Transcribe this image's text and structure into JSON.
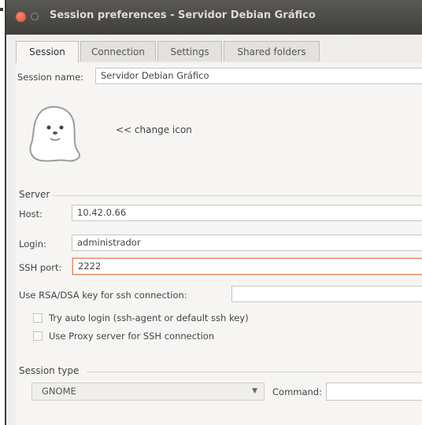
{
  "window": {
    "title": "Session preferences - Servidor Debian Gráfico"
  },
  "tabs": [
    {
      "label": "Session"
    },
    {
      "label": "Connection"
    },
    {
      "label": "Settings"
    },
    {
      "label": "Shared folders"
    }
  ],
  "session": {
    "name_label": "Session name:",
    "name_value": "Servidor Debian Gráfico",
    "change_icon_label": "<< change icon"
  },
  "server": {
    "section_label": "Server",
    "host_label": "Host:",
    "host_value": "10.42.0.66",
    "login_label": "Login:",
    "login_value": "administrador",
    "ssh_port_label": "SSH port:",
    "ssh_port_value": "2222",
    "rsa_label": "Use RSA/DSA key for ssh connection:",
    "rsa_value": "",
    "auto_login_label": "Try auto login (ssh-agent or default ssh key)",
    "proxy_label": "Use Proxy server for SSH connection"
  },
  "session_type": {
    "section_label": "Session type",
    "selected": "GNOME",
    "command_label": "Command:",
    "command_value": ""
  },
  "colors": {
    "titlebar": "#4a4945",
    "close_button": "#e0563a",
    "focus_border": "#e58a63"
  }
}
